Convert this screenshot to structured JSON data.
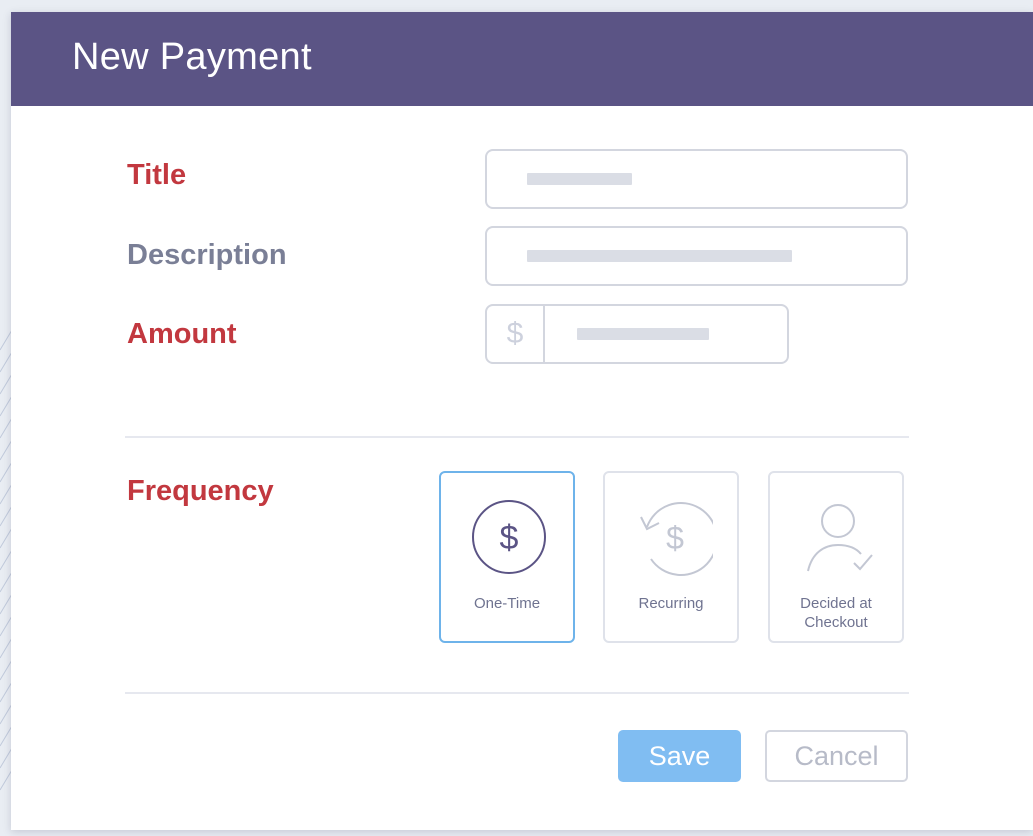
{
  "modal": {
    "title": "New Payment"
  },
  "form": {
    "title_label": "Title",
    "description_label": "Description",
    "amount_label": "Amount",
    "currency_symbol": "$",
    "frequency_label": "Frequency"
  },
  "frequency_options": [
    {
      "label": "One-Time",
      "icon": "dollar-circle-icon",
      "selected": true
    },
    {
      "label": "Recurring",
      "icon": "recurring-dollar-icon",
      "selected": false
    },
    {
      "label_line1": "Decided at",
      "label_line2": "Checkout",
      "icon": "user-check-icon",
      "selected": false
    }
  ],
  "actions": {
    "save_label": "Save",
    "cancel_label": "Cancel"
  },
  "colors": {
    "header": "#5b5485",
    "required_label": "#c2383f",
    "optional_label": "#7a7f96",
    "primary_button": "#80bdf2",
    "selected_border": "#6eb3ea"
  }
}
